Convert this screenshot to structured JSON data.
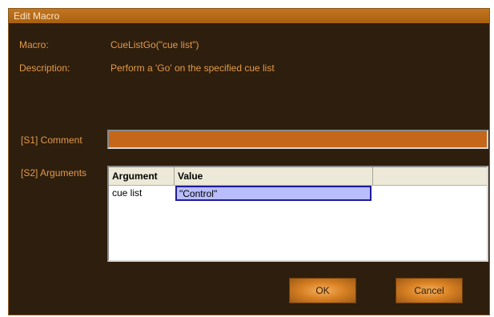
{
  "window": {
    "title": "Edit Macro"
  },
  "info": {
    "macro_label": "Macro:",
    "macro_value": "CueListGo(\"cue list\")",
    "description_label": "Description:",
    "description_value": "Perform a 'Go' on the specified cue list"
  },
  "comment": {
    "label": "[S1] Comment",
    "value": ""
  },
  "arguments": {
    "label": "[S2] Arguments",
    "columns": [
      "Argument",
      "Value",
      ""
    ],
    "rows": [
      {
        "argument": "cue list",
        "value": "\"Control\""
      }
    ]
  },
  "buttons": {
    "ok": "OK",
    "cancel": "Cancel"
  },
  "colors": {
    "background": "#2e1e0d",
    "label_text": "#e39a49",
    "titlebar": "#b86a18",
    "comment_field": "#c4671a",
    "selected_cell": "#b9bdfb",
    "selected_border": "#1e1c9c"
  }
}
